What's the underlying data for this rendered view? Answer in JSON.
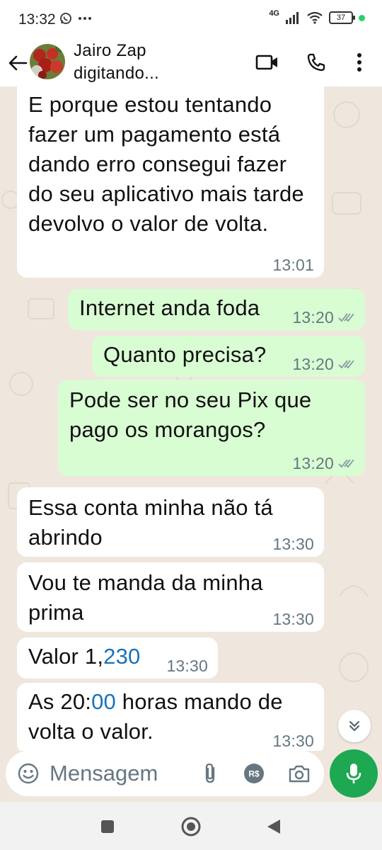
{
  "status_bar": {
    "time": "13:32",
    "network": "4G",
    "battery": "37"
  },
  "header": {
    "contact_name": "Jairo Zap",
    "contact_status": "digitando..."
  },
  "messages": [
    {
      "direction": "in",
      "text": "E porque estou tentando fazer um pagamento está dando erro consegui fazer do seu aplicativo mais tarde devolvo o valor de volta.",
      "time": "13:01"
    },
    {
      "direction": "out",
      "text": "Internet anda foda",
      "time": "13:20",
      "status": "delivered"
    },
    {
      "direction": "out",
      "text": "Quanto precisa?",
      "time": "13:20",
      "status": "delivered"
    },
    {
      "direction": "out",
      "text": "Pode ser no seu Pix que pago os morangos?",
      "time": "13:20",
      "status": "delivered"
    },
    {
      "direction": "in",
      "text": "Essa conta minha não tá abrindo",
      "time": "13:30"
    },
    {
      "direction": "in",
      "text": "Vou te manda da minha prima",
      "time": "13:30"
    },
    {
      "direction": "in",
      "text_prefix": "Valor 1,",
      "text_link": "230",
      "time": "13:30"
    },
    {
      "direction": "in",
      "text_prefix": "As 20:",
      "text_link": "00",
      "text_suffix": " horas mando de volta o valor.",
      "time": "13:30"
    }
  ],
  "input": {
    "placeholder": "Mensagem"
  },
  "colors": {
    "outgoing_bubble": "#d9fdd3",
    "incoming_bubble": "#ffffff",
    "chat_background": "#efe7de",
    "accent_green": "#1da851",
    "link_blue": "#1a73b8"
  },
  "icons": [
    "back-arrow-icon",
    "video-call-icon",
    "phone-icon",
    "more-vert-icon",
    "emoji-icon",
    "attach-icon",
    "payment-icon",
    "camera-icon",
    "mic-icon",
    "scroll-down-icon",
    "nav-recents-icon",
    "nav-home-icon",
    "nav-back-icon"
  ]
}
